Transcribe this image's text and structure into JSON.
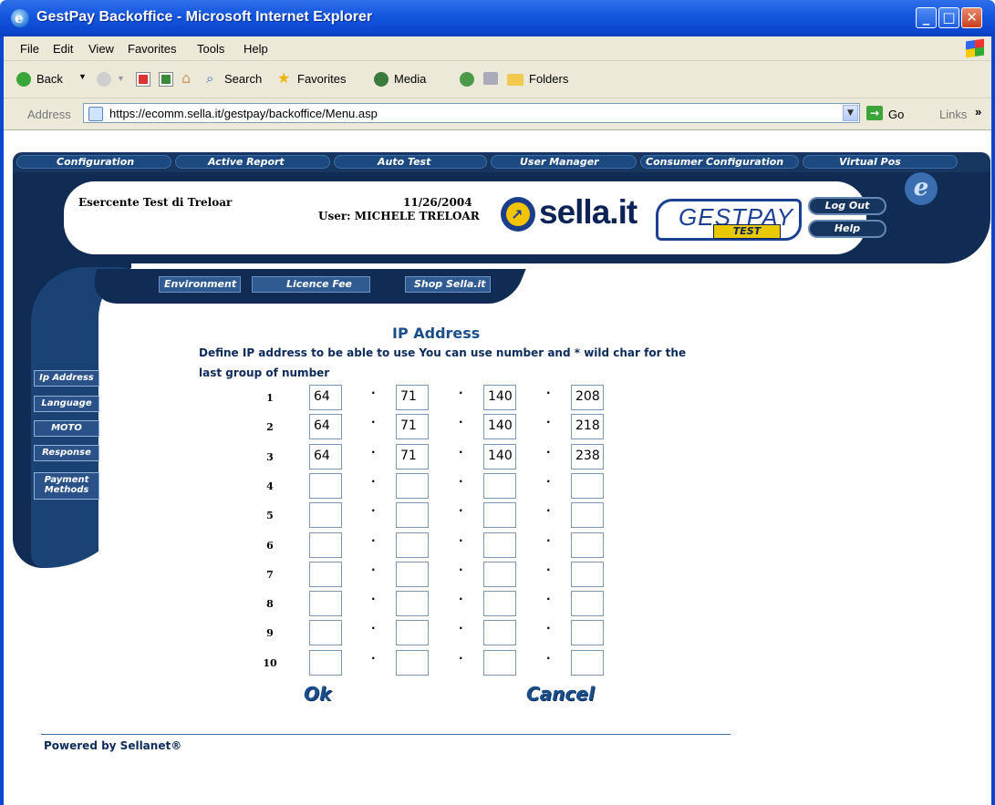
{
  "window": {
    "title": "GestPay Backoffice - Microsoft Internet Explorer",
    "controls": [
      "minimize",
      "maximize",
      "close"
    ]
  },
  "menubar": {
    "items": [
      "File",
      "Edit",
      "View",
      "Favorites",
      "Tools",
      "Help"
    ]
  },
  "toolbar": {
    "back": "Back",
    "search": "Search",
    "favorites": "Favorites",
    "media": "Media",
    "folders": "Folders"
  },
  "addressbar": {
    "label": "Address",
    "url": "https://ecomm.sella.it/gestpay/backoffice/Menu.asp",
    "go": "Go",
    "links": "Links",
    "more": "»"
  },
  "topnav": {
    "items": [
      "Configuration",
      "Active Report",
      "Auto Test",
      "User Manager",
      "Consumer Configuration",
      "Virtual Pos"
    ]
  },
  "header": {
    "merchant": "Esercente Test di Treloar",
    "date": "11/26/2004",
    "user": "User: MICHELE TRELOAR",
    "brand": "sella.it",
    "product": "GESTPAY",
    "product_badge": "TEST",
    "logout": "Log Out",
    "help": "Help"
  },
  "subnav": {
    "items": [
      "Environment",
      "Licence Fee",
      "Shop Sella.it"
    ]
  },
  "sidebar": {
    "items": [
      "Ip Address",
      "Language",
      "MOTO",
      "Response",
      "Payment Methods"
    ]
  },
  "form": {
    "title": "IP Address",
    "instruction": "Define IP address to be able to use You can use number and * wild char for the last group of number",
    "separator": ".",
    "rows": [
      {
        "num": "1",
        "values": [
          "64",
          "71",
          "140",
          "208"
        ]
      },
      {
        "num": "2",
        "values": [
          "64",
          "71",
          "140",
          "218"
        ]
      },
      {
        "num": "3",
        "values": [
          "64",
          "71",
          "140",
          "238"
        ]
      },
      {
        "num": "4",
        "values": [
          "",
          "",
          "",
          ""
        ]
      },
      {
        "num": "5",
        "values": [
          "",
          "",
          "",
          ""
        ]
      },
      {
        "num": "6",
        "values": [
          "",
          "",
          "",
          ""
        ]
      },
      {
        "num": "7",
        "values": [
          "",
          "",
          "",
          ""
        ]
      },
      {
        "num": "8",
        "values": [
          "",
          "",
          "",
          ""
        ]
      },
      {
        "num": "9",
        "values": [
          "",
          "",
          "",
          ""
        ]
      },
      {
        "num": "10",
        "values": [
          "",
          "",
          "",
          ""
        ]
      }
    ],
    "ok": "Ok",
    "cancel": "Cancel"
  },
  "footer": {
    "powered": "Powered by Sellanet®"
  }
}
